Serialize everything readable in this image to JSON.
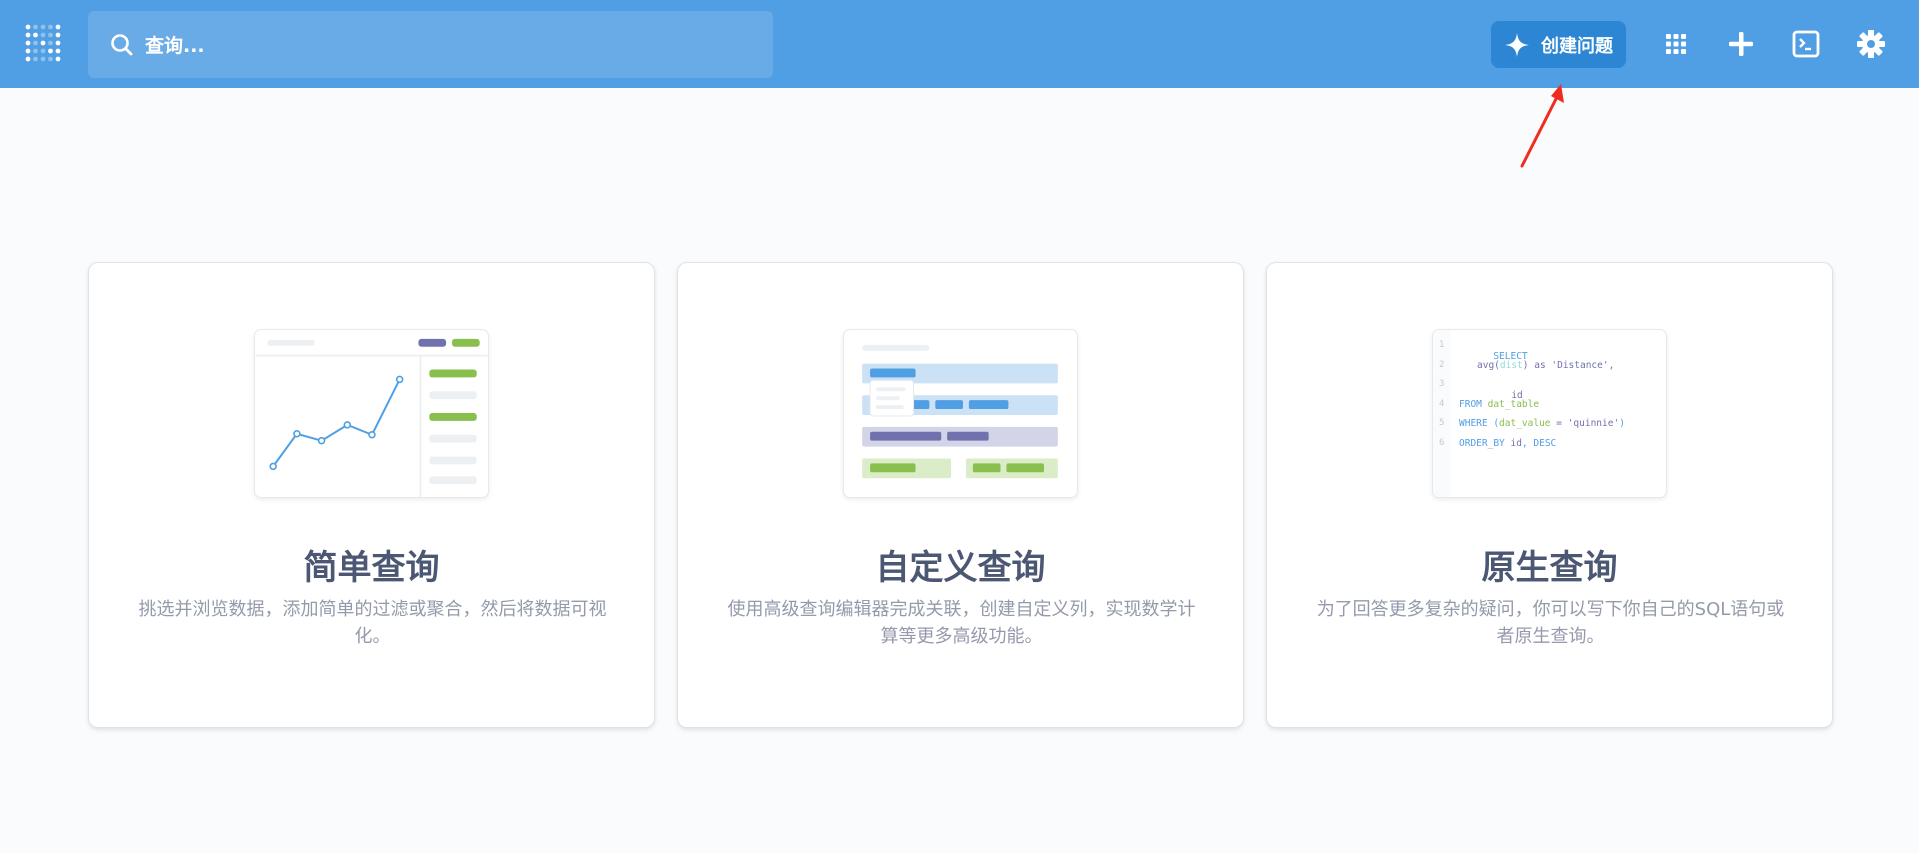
{
  "topbar": {
    "background": "#509ee3",
    "search_placeholder": "查询...",
    "create_button_label": "创建问题",
    "icons": [
      "apps-grid-icon",
      "plus-icon",
      "terminal-icon",
      "gear-icon"
    ]
  },
  "cards": [
    {
      "title": "简单查询",
      "description": "挑选并浏览数据，添加简单的过滤或聚合，然后将数据可视化。"
    },
    {
      "title": "自定义查询",
      "description": "使用高级查询编辑器完成关联，创建自定义列，实现数学计算等更多高级功能。"
    },
    {
      "title": "原生查询",
      "description": "为了回答更多复杂的疑问，你可以写下你自己的SQL语句或者原生查询。"
    }
  ],
  "sql_preview": {
    "line_numbers": [
      "1",
      "2",
      "3",
      "4",
      "5",
      "6"
    ],
    "lines": [
      [
        "SELECT"
      ],
      [
        "avg(",
        "dist",
        ") as ",
        "'Distance'",
        ","
      ],
      [
        "id"
      ],
      [
        "FROM ",
        "dat_table"
      ],
      [
        "WHERE (",
        "dat_value",
        " = ",
        "'quinnie'",
        ")"
      ],
      [
        "ORDER_BY ",
        "id",
        ", DESC"
      ]
    ]
  },
  "colors": {
    "accent": "#509ee3",
    "button": "#2d86d4",
    "title_text": "#4c5773",
    "desc_text": "#949aab",
    "green": "#88bf4d",
    "purple": "#7172ad",
    "annotation_arrow": "#f02b1f"
  }
}
